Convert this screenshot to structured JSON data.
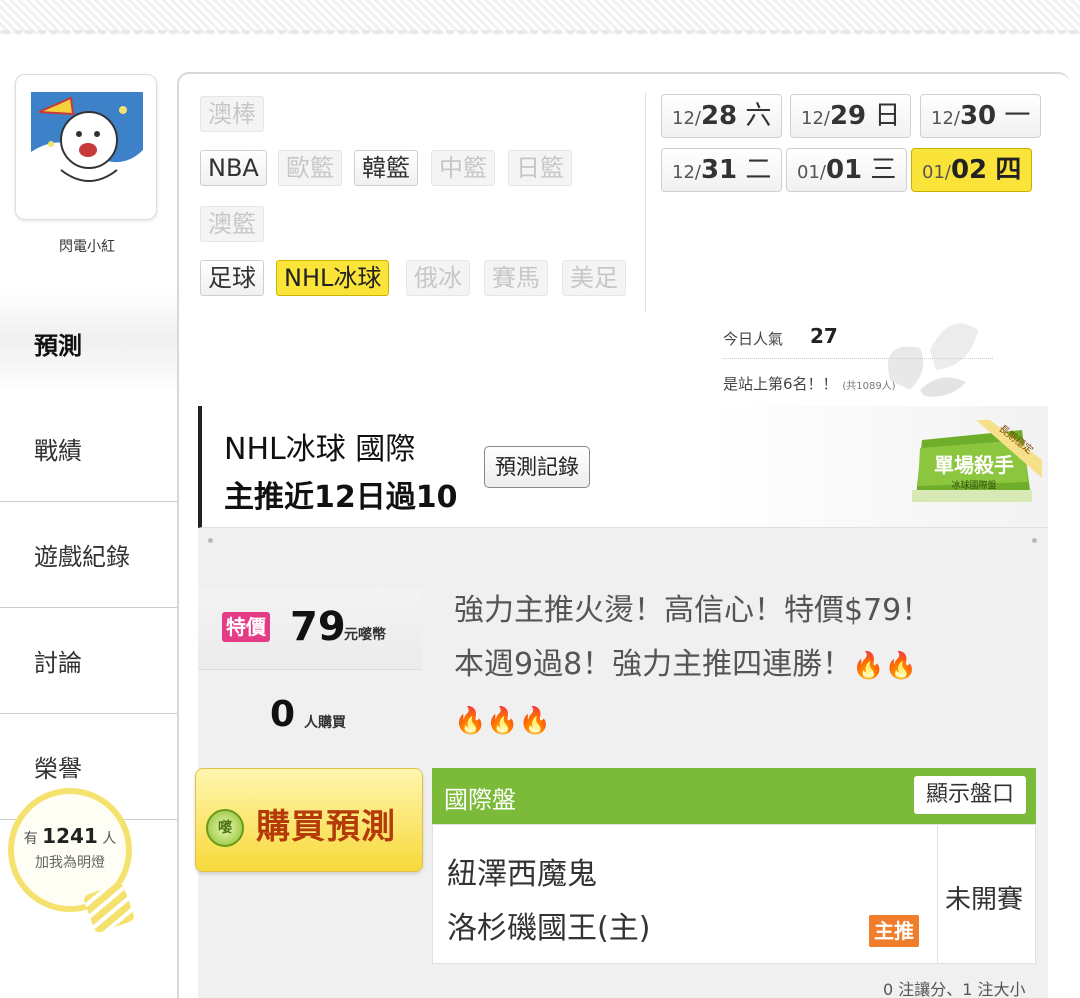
{
  "user": {
    "name": "閃電小紅",
    "fans_prefix": "有",
    "fans_count": "1241",
    "fans_unit": "人",
    "fans_label": "加我為明燈"
  },
  "nav": [
    {
      "label": "預測",
      "active": true
    },
    {
      "label": "戰績"
    },
    {
      "label": "遊戲紀錄"
    },
    {
      "label": "討論"
    },
    {
      "label": "榮譽"
    }
  ],
  "categories": {
    "aus_baseball": "澳棒",
    "nba": "NBA",
    "euro_bball": "歐籃",
    "kr_bball": "韓籃",
    "cn_bball": "中籃",
    "jp_bball": "日籃",
    "aus_bball": "澳籃",
    "soccer": "足球",
    "nhl": "NHL冰球",
    "ru_hockey": "俄冰",
    "horse": "賽馬",
    "nfl": "美足"
  },
  "dates": [
    {
      "month": "12/",
      "day": "28",
      "weekday": "六"
    },
    {
      "month": "12/",
      "day": "29",
      "weekday": "日"
    },
    {
      "month": "12/",
      "day": "30",
      "weekday": "一"
    },
    {
      "month": "12/",
      "day": "31",
      "weekday": "二"
    },
    {
      "month": "01/",
      "day": "01",
      "weekday": "三"
    },
    {
      "month": "01/",
      "day": "02",
      "weekday": "四",
      "selected": true
    }
  ],
  "popularity": {
    "label": "今日人氣",
    "value": "27",
    "rank_text": "是站上第6名！！",
    "rank_total": "(共1089人)"
  },
  "title_card": {
    "line1": "NHL冰球 國際",
    "line2": "主推近12日過10",
    "record_button": "預測記錄",
    "badge_main": "單場殺手",
    "badge_sub": "冰球國際盤",
    "badge_ribbon": "長期穩定"
  },
  "pricing": {
    "sale_tag": "特價",
    "price": "79",
    "unit": "元嘙幣",
    "buyers": "0",
    "buyers_unit": "人購買"
  },
  "promo": {
    "line1": "強力主推火燙！高信心！特價$79！",
    "line2": "本週9過8！強力主推四連勝！",
    "fire": "🔥"
  },
  "buy_button": {
    "coin": "嘙",
    "label": "購買預測"
  },
  "odds": {
    "title": "國際盤",
    "show_button": "顯示盤口",
    "team_away": "紐澤西魔鬼",
    "team_home": "洛杉磯國王(主)",
    "main_tag": "主推",
    "status": "未開賽",
    "summary": "0 注讓分、1 注大小"
  },
  "colors": {
    "accent_yellow": "#fbe43a",
    "odds_green": "#7cbb3a",
    "sale_pink": "#e33b86",
    "main_orange": "#ef7d2c"
  }
}
